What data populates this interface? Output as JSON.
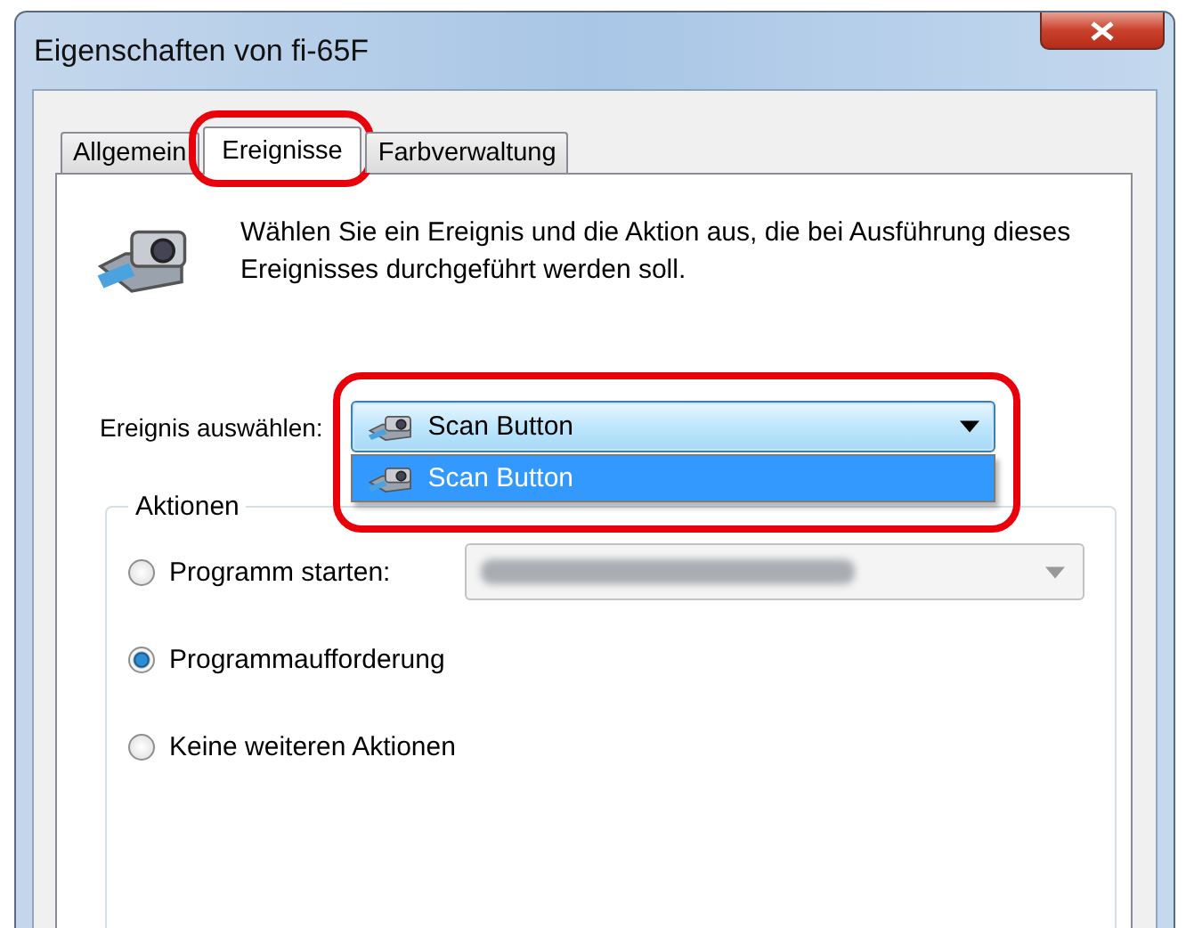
{
  "window": {
    "title": "Eigenschaften von fi-65F"
  },
  "tabs": [
    {
      "label": "Allgemein",
      "selected": false,
      "highlighted": false
    },
    {
      "label": "Ereignisse",
      "selected": true,
      "highlighted": true
    },
    {
      "label": "Farbverwaltung",
      "selected": false,
      "highlighted": false
    }
  ],
  "description": "Wählen Sie ein Ereignis und die Aktion aus, die bei Ausführung dieses Ereignisses durchgeführt werden soll.",
  "event_select": {
    "label": "Ereignis auswählen:",
    "value": "Scan Button",
    "expanded": true,
    "highlighted": true,
    "options": [
      {
        "label": "Scan Button",
        "selected": true
      }
    ]
  },
  "actions": {
    "title": "Aktionen",
    "options": [
      {
        "label": "Programm starten:",
        "selected": false,
        "kind": "with-select"
      },
      {
        "label": "Programmaufforderung",
        "selected": true,
        "kind": "plain"
      },
      {
        "label": "Keine weiteren Aktionen",
        "selected": false,
        "kind": "plain"
      }
    ],
    "program_select": {
      "disabled": true
    }
  }
}
